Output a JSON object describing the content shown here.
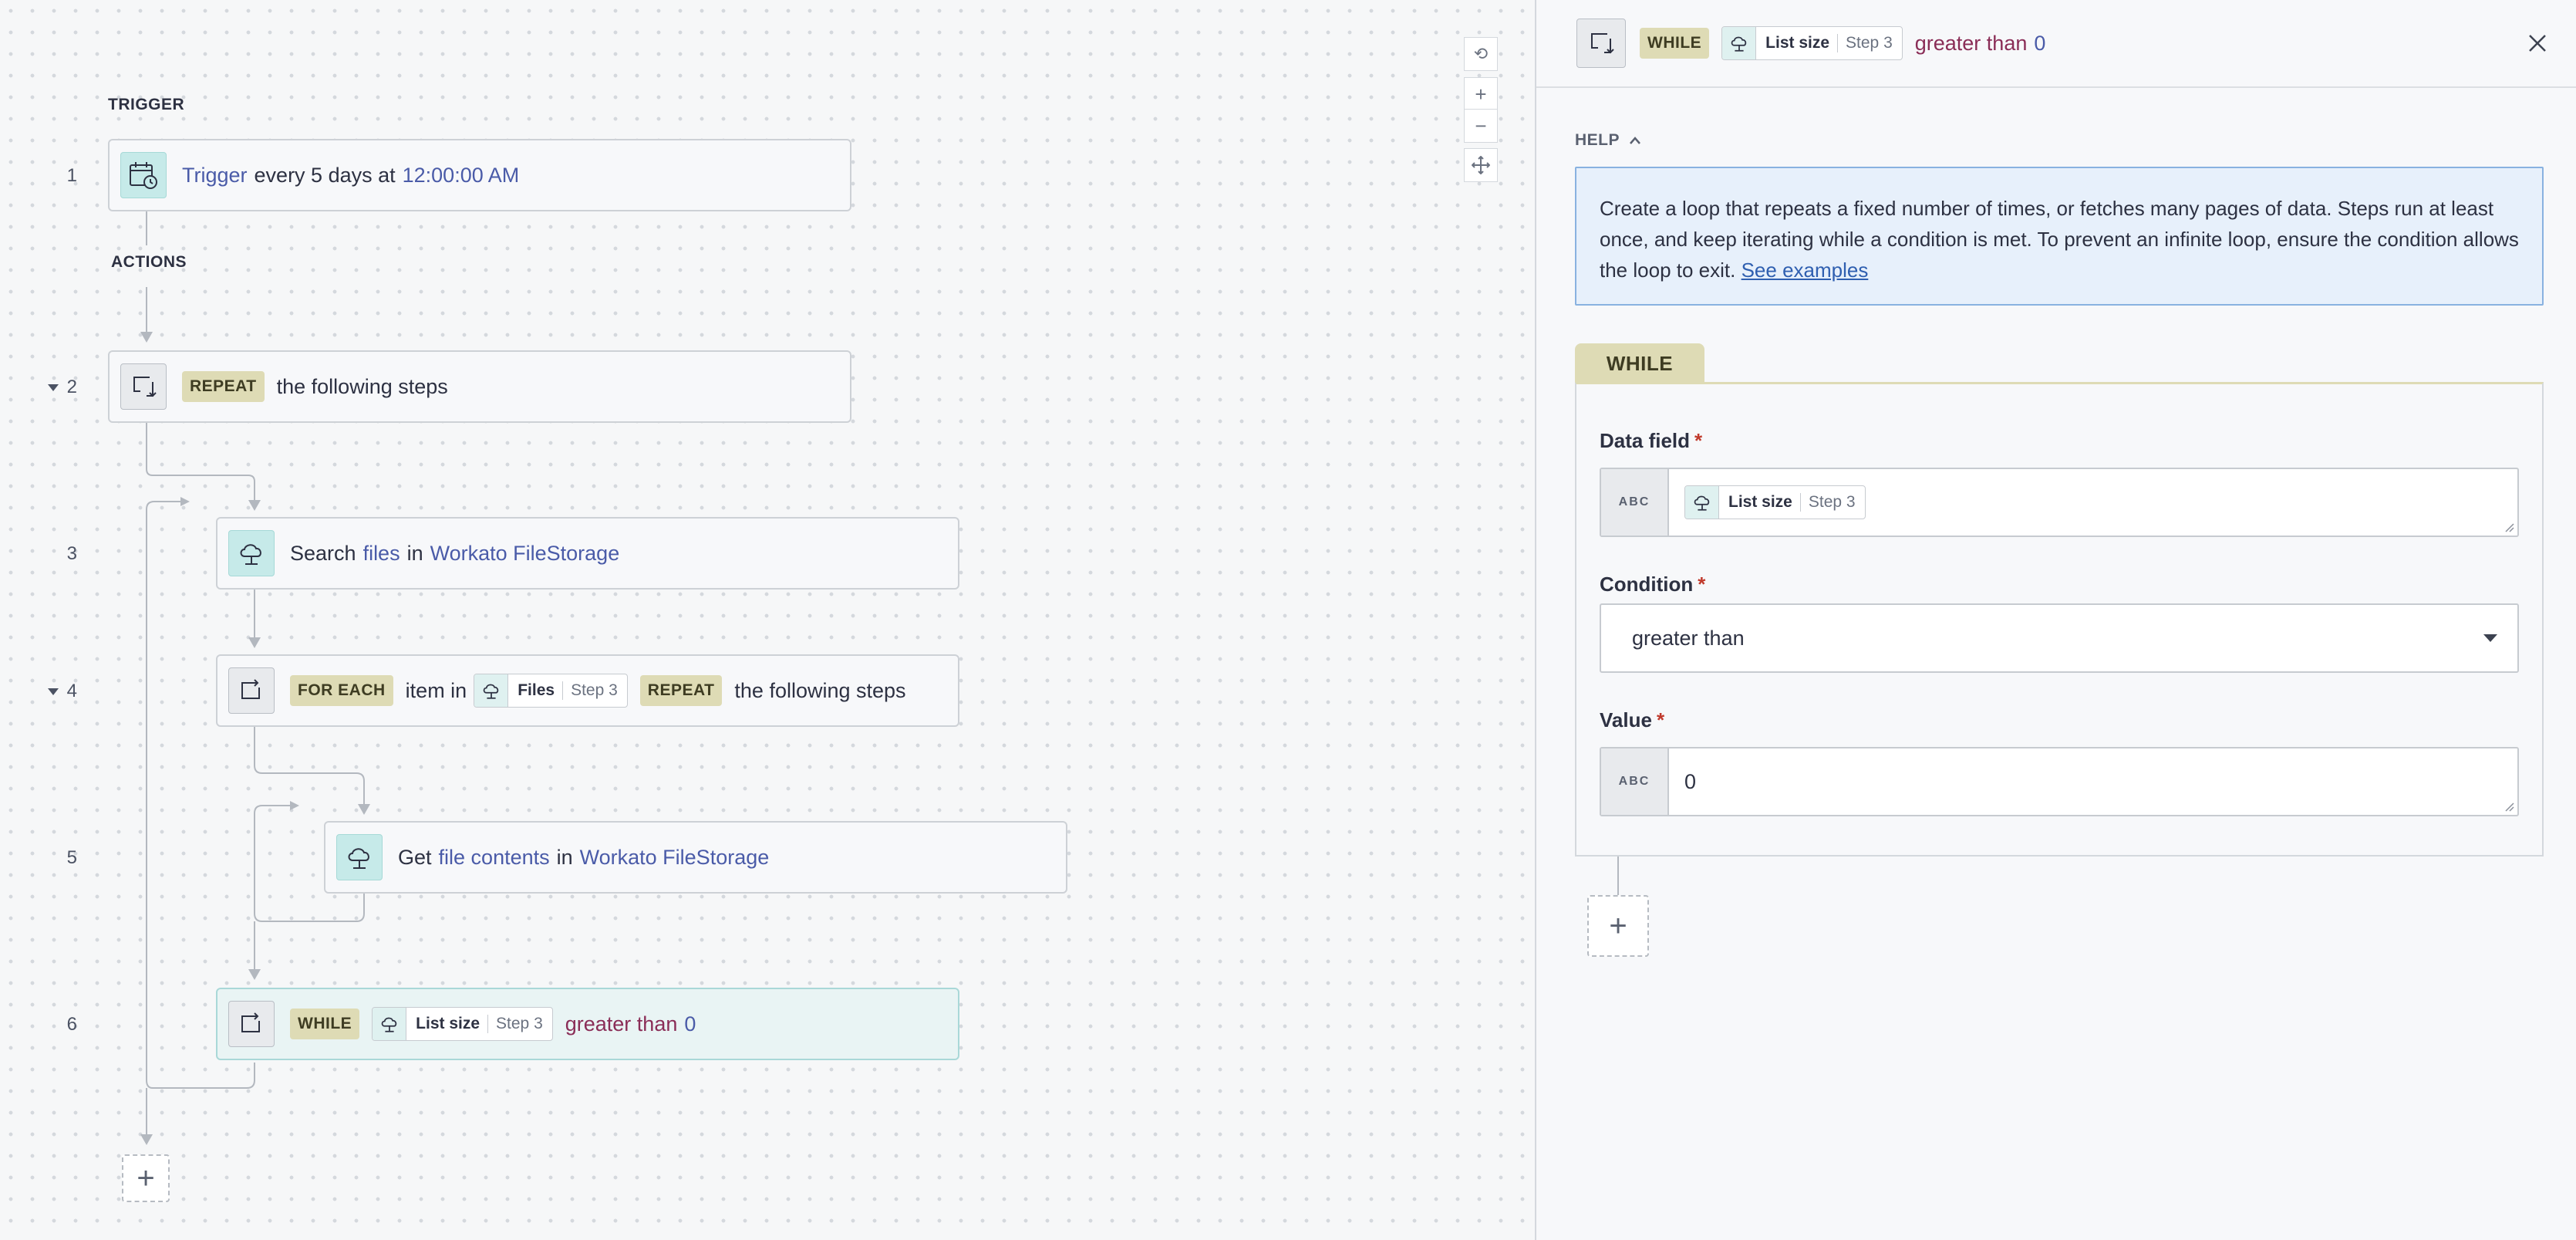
{
  "canvas": {
    "trigger_label": "TRIGGER",
    "actions_label": "ACTIONS",
    "steps": [
      {
        "num": "1",
        "app": "Trigger",
        "text1": "every 5 days at",
        "time": "12:00:00 AM"
      },
      {
        "num": "2",
        "keyword": "REPEAT",
        "text": "the following steps"
      },
      {
        "num": "3",
        "verb": "Search",
        "object": "files",
        "prep": "in",
        "app": "Workato FileStorage"
      },
      {
        "num": "4",
        "keyword": "FOR EACH",
        "text1": "item in",
        "pill_name": "Files",
        "pill_step": "Step 3",
        "keyword2": "REPEAT",
        "text2": "the following steps"
      },
      {
        "num": "5",
        "verb": "Get",
        "object": "file contents",
        "prep": "in",
        "app": "Workato FileStorage"
      },
      {
        "num": "6",
        "keyword": "WHILE",
        "pill_name": "List size",
        "pill_step": "Step 3",
        "condition": "greater than",
        "value": "0"
      }
    ],
    "add_step": "+"
  },
  "zoom_controls": {
    "reset": "⟲",
    "zoom_in": "+",
    "zoom_out": "−"
  },
  "panel": {
    "header": {
      "keyword": "WHILE",
      "pill_name": "List size",
      "pill_step": "Step 3",
      "condition": "greater than",
      "value": "0"
    },
    "help_label": "HELP",
    "help_text": "Create a loop that repeats a fixed number of times, or fetches many pages of data. Steps run at least once, and keep iterating while a condition is met. To prevent an infinite loop, ensure the condition allows the loop to exit.",
    "help_link": "See examples",
    "tab": "WHILE",
    "data_field": {
      "label": "Data field",
      "required": "*",
      "type": "ABC",
      "pill_name": "List size",
      "pill_step": "Step 3"
    },
    "condition": {
      "label": "Condition",
      "required": "*",
      "value": "greater than"
    },
    "value_field": {
      "label": "Value",
      "required": "*",
      "type": "ABC",
      "value": "0"
    },
    "add_step": "+"
  },
  "colors": {
    "keyword_bg": "#dedbb5",
    "link": "#4a5ba8",
    "condition": "#8a2d57",
    "active_step_bg": "#e9f4f4",
    "help_bg": "#e7f0fb"
  },
  "icons": [
    "calendar-clock-icon",
    "loop-icon",
    "cloud-storage-icon",
    "close-icon",
    "chevron-up-icon",
    "chevron-down-icon",
    "reset-icon",
    "zoom-in-icon",
    "zoom-out-icon",
    "fit-view-icon"
  ]
}
